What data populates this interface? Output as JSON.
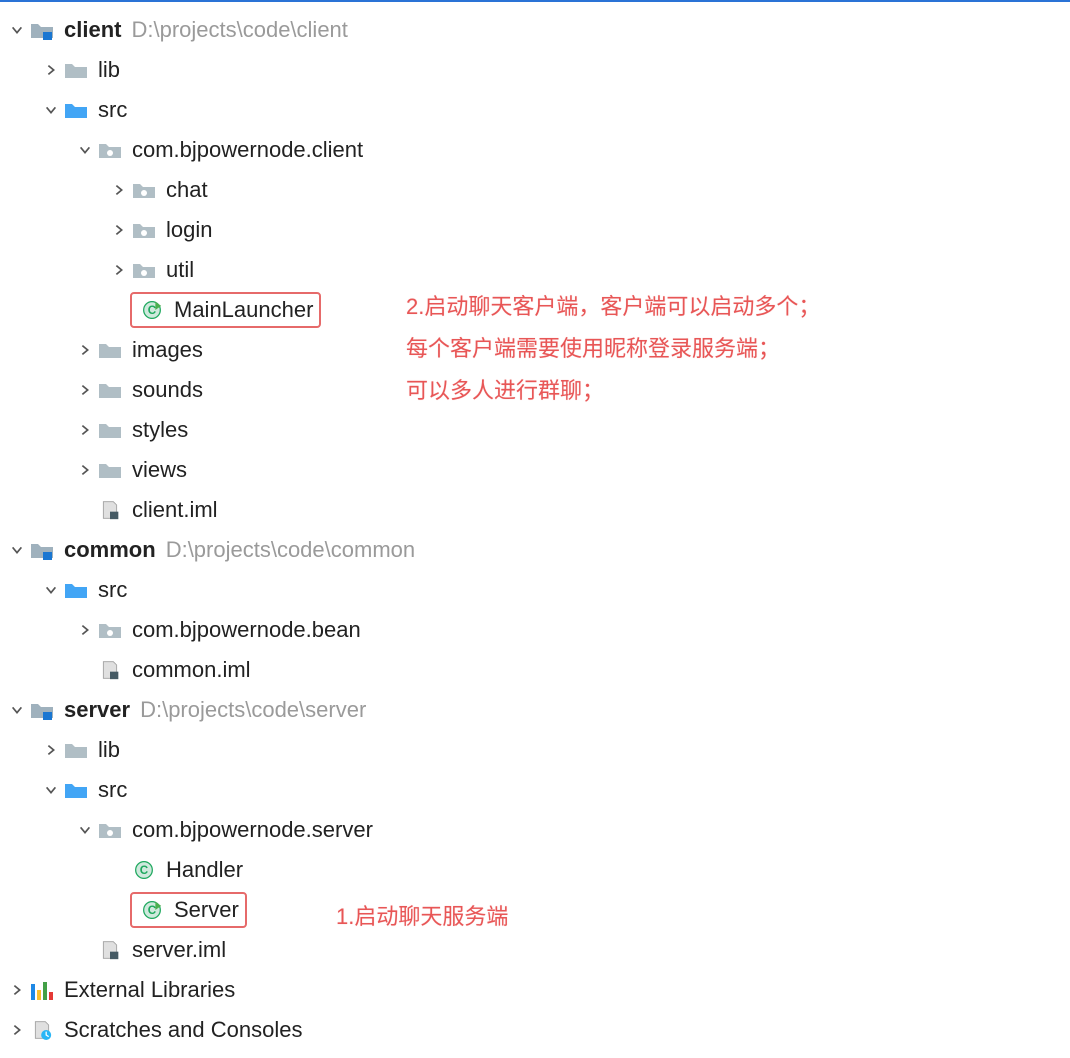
{
  "tree": {
    "client": {
      "name": "client",
      "path": "D:\\projects\\code\\client",
      "lib": "lib",
      "src": "src",
      "package": "com.bjpowernode.client",
      "chat": "chat",
      "login": "login",
      "util": "util",
      "mainLauncher": "MainLauncher",
      "images": "images",
      "sounds": "sounds",
      "styles": "styles",
      "views": "views",
      "iml": "client.iml"
    },
    "common": {
      "name": "common",
      "path": "D:\\projects\\code\\common",
      "src": "src",
      "package": "com.bjpowernode.bean",
      "iml": "common.iml"
    },
    "server": {
      "name": "server",
      "path": "D:\\projects\\code\\server",
      "lib": "lib",
      "src": "src",
      "package": "com.bjpowernode.server",
      "handler": "Handler",
      "serverClass": "Server",
      "iml": "server.iml"
    },
    "external": "External Libraries",
    "scratches": "Scratches and Consoles"
  },
  "annotations": {
    "note1": "1.启动聊天服务端",
    "note2_line1": "2.启动聊天客户端，客户端可以启动多个；",
    "note2_line2": "每个客户端需要使用昵称登录服务端；",
    "note2_line3": "可以多人进行群聊；"
  },
  "colors": {
    "accent": "#2a73d6",
    "annotation": "#e85656",
    "highlight_border": "#e66a6a",
    "path_gray": "#9a9a9a",
    "src_folder": "#42a5f5",
    "folder": "#b0bec5",
    "module": "#90a4ae",
    "class_circle": "#1ea85e",
    "run_triangle": "#4caf50"
  }
}
